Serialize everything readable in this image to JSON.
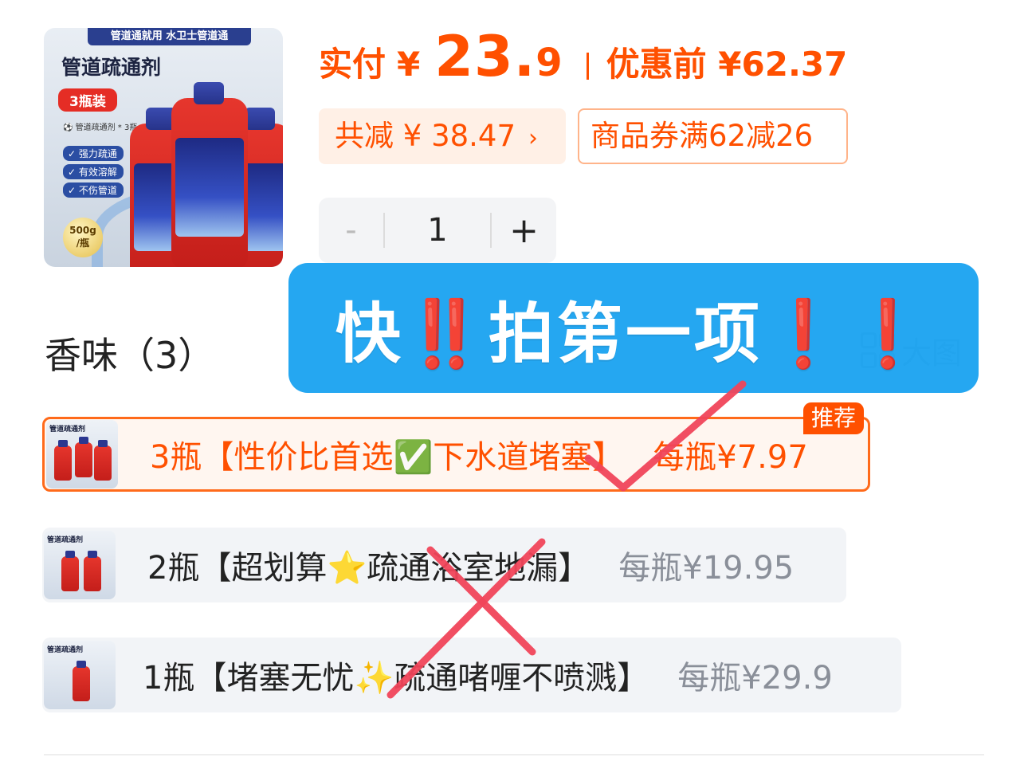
{
  "product": {
    "image": {
      "banner": "管道通就用 水卫士管道通",
      "title": "管道疏通剂",
      "pack": "3瓶装",
      "sub": "⚽ 管道疏通剂 * 3瓶",
      "features": [
        "✓ 强力疏通",
        "✓ 有效溶解",
        "✓ 不伤管道"
      ],
      "weight": "500g\n/瓶"
    }
  },
  "price": {
    "pay_label": "实付",
    "currency": "¥",
    "pay_int": "23.",
    "pay_dec": "9",
    "original_label": "优惠前 ¥62.37",
    "discount_label": "共减 ¥ 38.47",
    "discount_arrow": "›",
    "coupon_label": "商品券满62减26"
  },
  "stepper": {
    "minus": "-",
    "quantity": "1",
    "plus": "+"
  },
  "section": {
    "title": "香味（3）",
    "big_view": "大图"
  },
  "options": [
    {
      "label": "3瓶【性价比首选✅下水道堵塞】",
      "unit_price": "每瓶¥7.97",
      "selected": true,
      "badge": "推荐",
      "thumb_text": "管道疏通剂"
    },
    {
      "label": "2瓶【超划算⭐疏通浴室地漏】",
      "unit_price": "每瓶¥19.95",
      "selected": false,
      "thumb_text": "管道疏通剂"
    },
    {
      "label": "1瓶【堵塞无忧✨疏通啫喱不喷溅】",
      "unit_price": "每瓶¥29.9",
      "selected": false,
      "thumb_text": "管道疏通剂"
    }
  ],
  "overlay": {
    "text": "快‼️拍第一项❗️❗️"
  },
  "colors": {
    "accent": "#ff5000",
    "overlay_blue": "#14a0f0",
    "check": "#f0455a",
    "cross": "#f0455a",
    "muted": "#8a8f99"
  },
  "annotations": {
    "check_on": "option-1",
    "cross_on": "option-2-and-3"
  }
}
